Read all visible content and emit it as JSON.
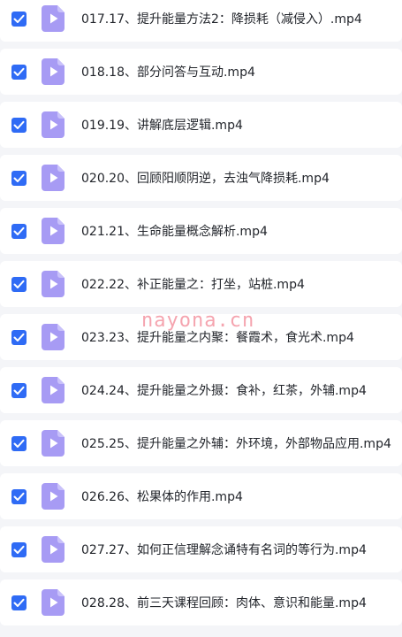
{
  "colors": {
    "checkbox": "#2f6bf5",
    "file_icon": "#a79bf4",
    "background": "#f4f5f8",
    "row_background": "#ffffff",
    "watermark": "#ec5a6e"
  },
  "files": [
    {
      "name": "017.17、提升能量方法2：降损耗（减侵入）.mp4",
      "checked": true,
      "icon": "video-file-icon"
    },
    {
      "name": "018.18、部分问答与互动.mp4",
      "checked": true,
      "icon": "video-file-icon"
    },
    {
      "name": "019.19、讲解底层逻辑.mp4",
      "checked": true,
      "icon": "video-file-icon"
    },
    {
      "name": "020.20、回顾阳顺阴逆，去浊气降损耗.mp4",
      "checked": true,
      "icon": "video-file-icon"
    },
    {
      "name": "021.21、生命能量概念解析.mp4",
      "checked": true,
      "icon": "video-file-icon"
    },
    {
      "name": "022.22、补正能量之：打坐，站桩.mp4",
      "checked": true,
      "icon": "video-file-icon"
    },
    {
      "name": "023.23、提升能量之内聚：餐霞术，食光术.mp4",
      "checked": true,
      "icon": "video-file-icon"
    },
    {
      "name": "024.24、提升能量之外摄：食补，红茶，外辅.mp4",
      "checked": true,
      "icon": "video-file-icon"
    },
    {
      "name": "025.25、提升能量之外辅：外环境，外部物品应用.mp4",
      "checked": true,
      "icon": "video-file-icon"
    },
    {
      "name": "026.26、松果体的作用.mp4",
      "checked": true,
      "icon": "video-file-icon"
    },
    {
      "name": "027.27、如何正信理解念诵特有名词的等行为.mp4",
      "checked": true,
      "icon": "video-file-icon"
    },
    {
      "name": "028.28、前三天课程回顾：肉体、意识和能量.mp4",
      "checked": true,
      "icon": "video-file-icon"
    }
  ],
  "watermark": {
    "text": "nayona.cn"
  }
}
